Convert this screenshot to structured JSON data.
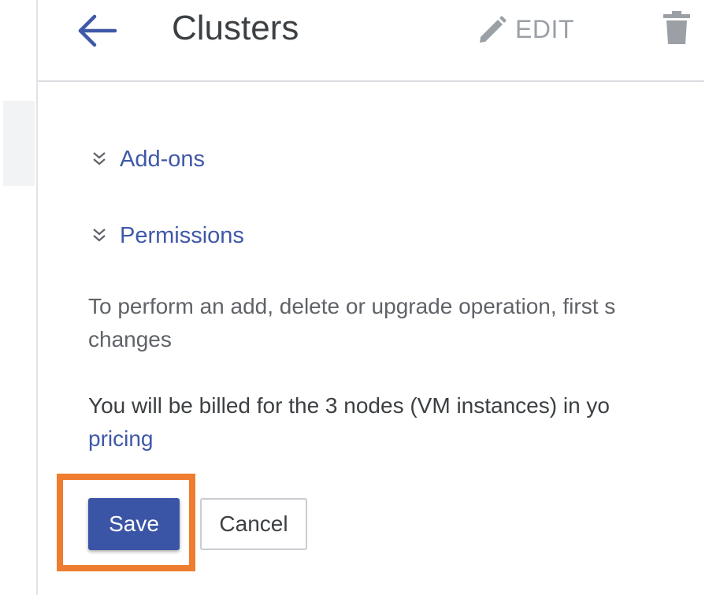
{
  "header": {
    "back_icon": "arrow-left-icon",
    "title": "Clusters",
    "edit_icon": "pencil-icon",
    "edit_label": "EDIT",
    "delete_icon": "trash-icon"
  },
  "sections": [
    {
      "label": "Add-ons",
      "icon": "double-chevron-down-icon"
    },
    {
      "label": "Permissions",
      "icon": "double-chevron-down-icon"
    }
  ],
  "messages": {
    "info_line1": "To perform an add, delete or upgrade operation, first s",
    "info_line2": "changes",
    "billing_line1": "You will be billed for the 3 nodes (VM instances) in yo",
    "pricing_link": "pricing"
  },
  "actions": {
    "save_label": "Save",
    "cancel_label": "Cancel"
  },
  "colors": {
    "accent_blue": "#3b55a6",
    "link_blue": "#3f58a8",
    "highlight_orange": "#ee7d2f",
    "title_text": "#3c4043",
    "muted_icon": "#9aa0a6"
  }
}
